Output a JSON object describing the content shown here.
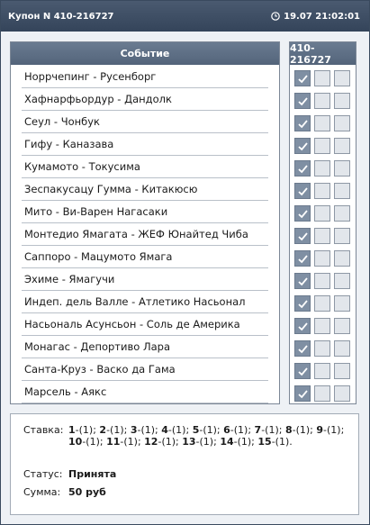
{
  "header": {
    "title": "Купон N 410-216727",
    "datetime": "19.07 21:02:01",
    "clock_icon": "clock-icon"
  },
  "events": {
    "column_title": "Событие",
    "items": [
      "Норрчепинг - Русенборг",
      "Хафнарфьордур - Дандолк",
      "Сеул - Чонбук",
      "Гифу - Каназава",
      "Кумамото - Токусима",
      "Зеспакусацу Гумма - Китакюсю",
      "Мито - Ви-Варен Нагасаки",
      "Монтедио Ямагата - ЖЕФ Юнайтед Чиба",
      "Саппоро - Мацумото Ямага",
      "Эхиме - Ямагучи",
      "Индеп. дель Валле - Атлетико Насьонал",
      "Насьональ Асунсьон - Соль де Америка",
      "Монагас - Депортиво Лара",
      "Санта-Круз - Васко да Гама",
      "Марсель - Аякс"
    ]
  },
  "coupon": {
    "column_title": "410-216727",
    "checked_column": 1,
    "columns": 3
  },
  "summary": {
    "stake_label": "Ставка:",
    "stakes": [
      {
        "n": "1",
        "v": "-(1);"
      },
      {
        "n": "2",
        "v": "-(1);"
      },
      {
        "n": "3",
        "v": "-(1);"
      },
      {
        "n": "4",
        "v": "-(1);"
      },
      {
        "n": "5",
        "v": "-(1);"
      },
      {
        "n": "6",
        "v": "-(1);"
      },
      {
        "n": "7",
        "v": "-(1);"
      },
      {
        "n": "8",
        "v": "-(1);"
      },
      {
        "n": "9",
        "v": "-(1);"
      },
      {
        "n": "10",
        "v": "-(1);"
      },
      {
        "n": "11",
        "v": "-(1);"
      },
      {
        "n": "12",
        "v": "-(1);"
      },
      {
        "n": "13",
        "v": "-(1);"
      },
      {
        "n": "14",
        "v": "-(1);"
      },
      {
        "n": "15",
        "v": "-(1)."
      }
    ],
    "status_label": "Статус:",
    "status_value": "Принята",
    "sum_label": "Сумма:",
    "sum_value": "50 руб"
  },
  "colors": {
    "header_bg": "#3e4e64",
    "checked": "#7f8fa3",
    "unchecked": "#e2e6eb"
  }
}
